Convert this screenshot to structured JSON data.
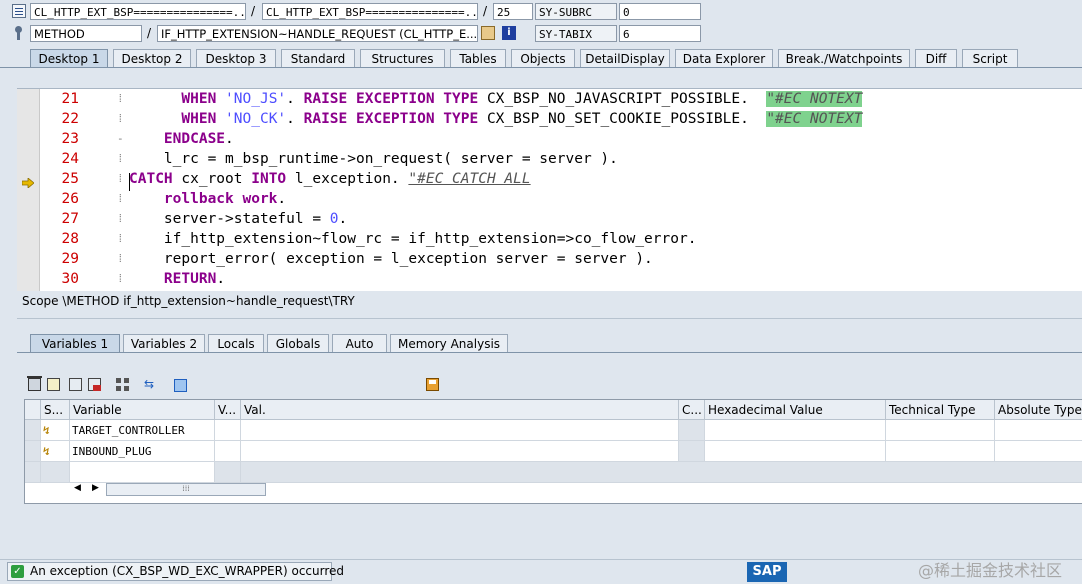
{
  "header": {
    "row1": {
      "field1": "CL_HTTP_EXT_BSP===============...",
      "sep1": "/",
      "field2": "CL_HTTP_EXT_BSP===============...",
      "sep2": "/",
      "field3": "25",
      "var_label": "SY-SUBRC",
      "var_value": "0"
    },
    "row2": {
      "field1": "METHOD",
      "sep1": "/",
      "field2": "IF_HTTP_EXTENSION~HANDLE_REQUEST (CL_HTTP_E...",
      "var_label": "SY-TABIX",
      "var_value": "6"
    }
  },
  "tabs": [
    {
      "label": "Desktop 1",
      "active": true
    },
    {
      "label": "Desktop 2",
      "active": false
    },
    {
      "label": "Desktop 3",
      "active": false
    },
    {
      "label": "Standard",
      "active": false
    },
    {
      "label": "Structures",
      "active": false
    },
    {
      "label": "Tables",
      "active": false
    },
    {
      "label": "Objects",
      "active": false
    },
    {
      "label": "DetailDisplay",
      "active": false
    },
    {
      "label": "Data Explorer",
      "active": false
    },
    {
      "label": "Break./Watchpoints",
      "active": false
    },
    {
      "label": "Diff",
      "active": false
    },
    {
      "label": "Script",
      "active": false
    }
  ],
  "code": {
    "lines": [
      {
        "num": "21",
        "ctx": "",
        "indent": "      ",
        "tokens": [
          [
            "kw",
            "WHEN "
          ],
          [
            "str",
            "'NO_JS'"
          ],
          [
            "",
            "."
          ],
          [
            "kw",
            " RAISE EXCEPTION TYPE "
          ],
          [
            "",
            "CX_BSP_NO_JAVASCRIPT_POSSIBLE.  "
          ],
          [
            "hlc",
            "\"#EC NOTEXT"
          ]
        ]
      },
      {
        "num": "22",
        "ctx": "",
        "indent": "      ",
        "tokens": [
          [
            "kw",
            "WHEN "
          ],
          [
            "str",
            "'NO_CK'"
          ],
          [
            "",
            "."
          ],
          [
            "kw",
            " RAISE EXCEPTION TYPE "
          ],
          [
            "",
            "CX_BSP_NO_SET_COOKIE_POSSIBLE.  "
          ],
          [
            "hlc",
            "\"#EC NOTEXT"
          ]
        ]
      },
      {
        "num": "23",
        "ctx": "-",
        "indent": "    ",
        "tokens": [
          [
            "kw",
            "ENDCASE"
          ],
          [
            "",
            "."
          ]
        ]
      },
      {
        "num": "24",
        "ctx": "",
        "indent": "    ",
        "tokens": [
          [
            "",
            "l_rc = m_bsp_runtime->on_request( server = server )."
          ]
        ]
      },
      {
        "num": "25",
        "ctx": "",
        "indent": "",
        "tokens": [
          [
            "kw",
            "CATCH "
          ],
          [
            "",
            "cx_root "
          ],
          [
            "kw",
            "INTO "
          ],
          [
            "",
            "l_exception. "
          ],
          [
            "ulc",
            "\"#EC CATCH ALL"
          ]
        ]
      },
      {
        "num": "26",
        "ctx": "",
        "indent": "    ",
        "tokens": [
          [
            "kw",
            "rollback work"
          ],
          [
            "",
            "."
          ]
        ]
      },
      {
        "num": "27",
        "ctx": "",
        "indent": "    ",
        "tokens": [
          [
            "",
            "server->stateful = "
          ],
          [
            "num",
            "0"
          ],
          [
            "",
            "."
          ]
        ]
      },
      {
        "num": "28",
        "ctx": "",
        "indent": "    ",
        "tokens": [
          [
            "",
            "if_http_extension~flow_rc = if_http_extension=>co_flow_error."
          ]
        ]
      },
      {
        "num": "29",
        "ctx": "",
        "indent": "    ",
        "tokens": [
          [
            "",
            "report_error( exception = l_exception server = server )."
          ]
        ]
      },
      {
        "num": "30",
        "ctx": "",
        "indent": "    ",
        "tokens": [
          [
            "kw",
            "RETURN"
          ],
          [
            "",
            "."
          ]
        ]
      }
    ],
    "current_line": "25"
  },
  "scope": "Scope \\METHOD if_http_extension~handle_request\\TRY",
  "var_tabs": [
    {
      "label": "Variables 1",
      "active": true
    },
    {
      "label": "Variables 2",
      "active": false
    },
    {
      "label": "Locals",
      "active": false
    },
    {
      "label": "Globals",
      "active": false
    },
    {
      "label": "Auto",
      "active": false
    },
    {
      "label": "Memory Analysis",
      "active": false
    }
  ],
  "grid": {
    "headers": [
      "S...",
      "Variable",
      "V...",
      "Val.",
      "C...",
      "Hexadecimal Value",
      "Technical Type",
      "Absolute Type"
    ],
    "rows": [
      {
        "variable": "TARGET_CONTROLLER"
      },
      {
        "variable": "INBOUND_PLUG"
      },
      {
        "variable": ""
      }
    ]
  },
  "status": {
    "message": "An exception (CX_BSP_WD_EXC_WRAPPER) occurred"
  },
  "brand": {
    "logo": "SAP",
    "watermark": "@稀土掘金技术社区"
  },
  "colors": {
    "keyword": "#8b008b",
    "string": "#4d4dff",
    "line_number": "#cc0000",
    "comment_highlight": "#7fd28e"
  }
}
